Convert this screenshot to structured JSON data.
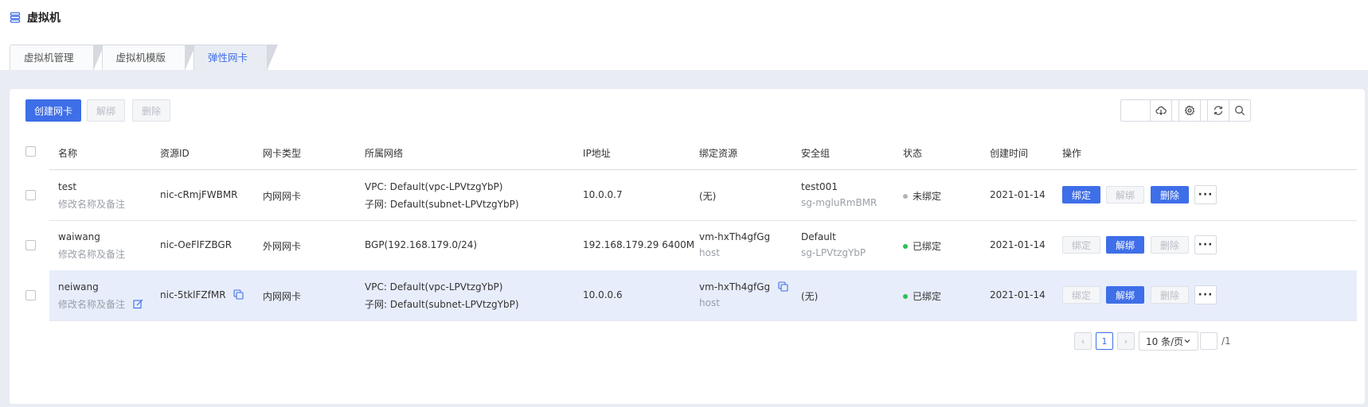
{
  "page": {
    "title": "虚拟机"
  },
  "tabs": [
    {
      "label": "虚拟机管理",
      "active": false
    },
    {
      "label": "虚拟机模版",
      "active": false
    },
    {
      "label": "弹性网卡",
      "active": true
    }
  ],
  "toolbar": {
    "create_label": "创建网卡",
    "unbind_label": "解绑",
    "delete_label": "删除",
    "search_placeholder": ""
  },
  "table": {
    "columns": [
      "名称",
      "资源ID",
      "网卡类型",
      "所属网络",
      "IP地址",
      "绑定资源",
      "安全组",
      "状态",
      "创建时间",
      "操作"
    ],
    "rows": [
      {
        "name": "test",
        "remark": "修改名称及备注",
        "resource_id": "nic-cRmjFWBMR",
        "nic_type": "内网网卡",
        "network_line1": "VPC: Default(vpc-LPVtzgYbP)",
        "network_line2": "子网: Default(subnet-LPVtzgYbP)",
        "ip": "10.0.0.7",
        "bound_line1": "(无)",
        "bound_line2": "",
        "sg_line1": "test001",
        "sg_line2": "sg-mgluRmBMR",
        "status": "未绑定",
        "status_color": "#b0b4bb",
        "created": "2021-01-14",
        "actions": {
          "bind": "绑定",
          "unbind": "解绑",
          "delete": "删除"
        }
      },
      {
        "name": "waiwang",
        "remark": "修改名称及备注",
        "resource_id": "nic-OeFlFZBGR",
        "nic_type": "外网网卡",
        "network_line1": "BGP(192.168.179.0/24)",
        "network_line2": "",
        "ip": "192.168.179.29 6400M",
        "bound_line1": "vm-hxTh4gfGg",
        "bound_line2": "host",
        "sg_line1": "Default",
        "sg_line2": "sg-LPVtzgYbP",
        "status": "已绑定",
        "status_color": "#2bc154",
        "created": "2021-01-14",
        "actions": {
          "bind": "绑定",
          "unbind": "解绑",
          "delete": "删除"
        }
      },
      {
        "name": "neiwang",
        "remark": "修改名称及备注",
        "resource_id": "nic-5tklFZfMR",
        "nic_type": "内网网卡",
        "network_line1": "VPC: Default(vpc-LPVtzgYbP)",
        "network_line2": "子网: Default(subnet-LPVtzgYbP)",
        "ip": "10.0.0.6",
        "bound_line1": "vm-hxTh4gfGg",
        "bound_line2": "host",
        "sg_line1": "(无)",
        "sg_line2": "",
        "status": "已绑定",
        "status_color": "#2bc154",
        "created": "2021-01-14",
        "actions": {
          "bind": "绑定",
          "unbind": "解绑",
          "delete": "删除"
        }
      }
    ]
  },
  "pagination": {
    "prev": "‹",
    "current_page": "1",
    "next": "›",
    "page_size": "10 条/页",
    "total_pages": "/1"
  },
  "colors": {
    "accent": "#3e6ee8",
    "bound": "#2bc154",
    "unbound": "#b0b4bb",
    "highlight_row": "#e7edfb"
  },
  "icons": [
    "list-icon",
    "search-icon",
    "cloud-download-icon",
    "gear-icon",
    "refresh-icon",
    "copy-icon",
    "edit-icon",
    "more-icon",
    "chevron-down-icon"
  ]
}
